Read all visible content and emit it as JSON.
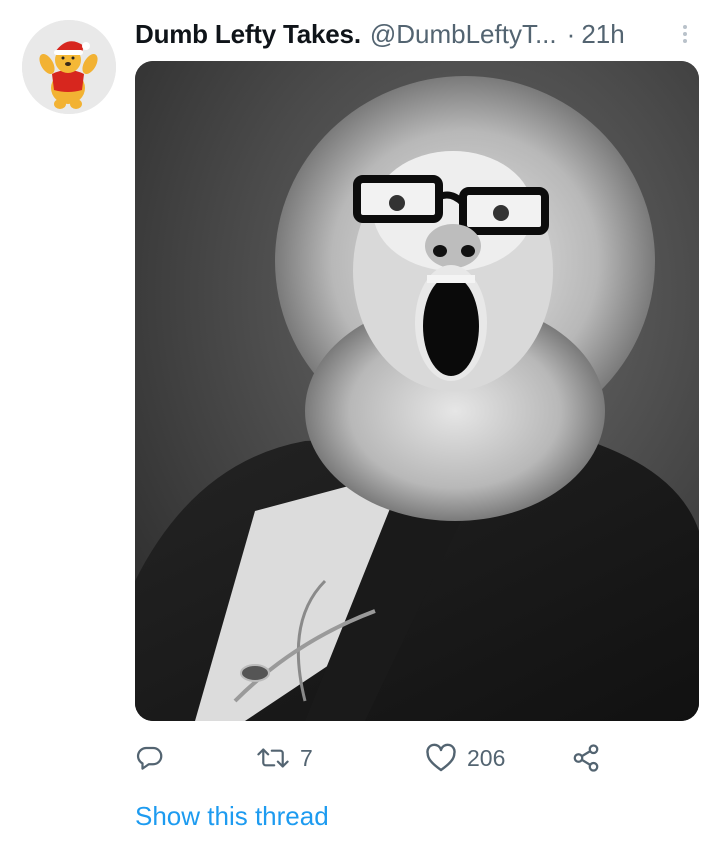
{
  "tweet": {
    "display_name": "Dumb Lefty Takes.",
    "handle": "@DumbLeftyT...",
    "separator": "·",
    "time": "21h",
    "retweet_count": "7",
    "like_count": "206",
    "show_thread_label": "Show this thread"
  },
  "icons": {
    "avatar": "winnie-the-pooh-santa-hat",
    "more": "vertical-ellipsis-icon",
    "reply": "reply-icon",
    "retweet": "retweet-icon",
    "like": "heart-icon",
    "share": "share-icon"
  },
  "colors": {
    "link": "#1d9bf0",
    "secondary_text": "#536471",
    "primary_text": "#0f1419"
  }
}
